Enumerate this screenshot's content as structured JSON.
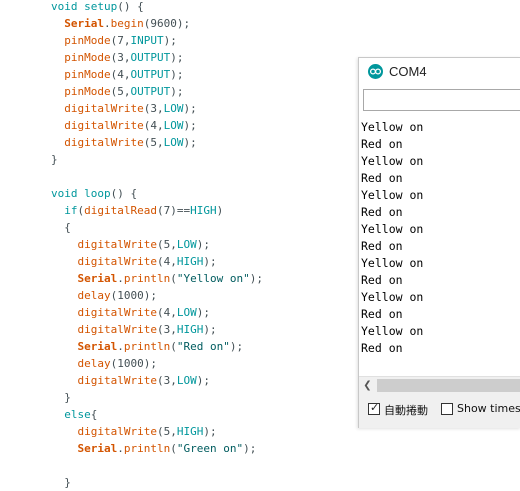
{
  "editor": {
    "lines": [
      [
        {
          "t": "void",
          "c": "kw"
        },
        {
          "t": " ",
          "c": "plain"
        },
        {
          "t": "setup",
          "c": "kw"
        },
        {
          "t": "() {",
          "c": "plain"
        }
      ],
      [
        {
          "t": "  ",
          "c": "plain"
        },
        {
          "t": "Serial",
          "c": "obj"
        },
        {
          "t": ".",
          "c": "plain"
        },
        {
          "t": "begin",
          "c": "builtin"
        },
        {
          "t": "(9600);",
          "c": "plain"
        }
      ],
      [
        {
          "t": "  ",
          "c": "plain"
        },
        {
          "t": "pinMode",
          "c": "builtin"
        },
        {
          "t": "(7,",
          "c": "plain"
        },
        {
          "t": "INPUT",
          "c": "kw"
        },
        {
          "t": ");",
          "c": "plain"
        }
      ],
      [
        {
          "t": "  ",
          "c": "plain"
        },
        {
          "t": "pinMode",
          "c": "builtin"
        },
        {
          "t": "(3,",
          "c": "plain"
        },
        {
          "t": "OUTPUT",
          "c": "kw"
        },
        {
          "t": ");",
          "c": "plain"
        }
      ],
      [
        {
          "t": "  ",
          "c": "plain"
        },
        {
          "t": "pinMode",
          "c": "builtin"
        },
        {
          "t": "(4,",
          "c": "plain"
        },
        {
          "t": "OUTPUT",
          "c": "kw"
        },
        {
          "t": ");",
          "c": "plain"
        }
      ],
      [
        {
          "t": "  ",
          "c": "plain"
        },
        {
          "t": "pinMode",
          "c": "builtin"
        },
        {
          "t": "(5,",
          "c": "plain"
        },
        {
          "t": "OUTPUT",
          "c": "kw"
        },
        {
          "t": ");",
          "c": "plain"
        }
      ],
      [
        {
          "t": "  ",
          "c": "plain"
        },
        {
          "t": "digitalWrite",
          "c": "builtin"
        },
        {
          "t": "(3,",
          "c": "plain"
        },
        {
          "t": "LOW",
          "c": "kw"
        },
        {
          "t": ");",
          "c": "plain"
        }
      ],
      [
        {
          "t": "  ",
          "c": "plain"
        },
        {
          "t": "digitalWrite",
          "c": "builtin"
        },
        {
          "t": "(4,",
          "c": "plain"
        },
        {
          "t": "LOW",
          "c": "kw"
        },
        {
          "t": ");",
          "c": "plain"
        }
      ],
      [
        {
          "t": "  ",
          "c": "plain"
        },
        {
          "t": "digitalWrite",
          "c": "builtin"
        },
        {
          "t": "(5,",
          "c": "plain"
        },
        {
          "t": "LOW",
          "c": "kw"
        },
        {
          "t": ");",
          "c": "plain"
        }
      ],
      [
        {
          "t": "}",
          "c": "plain"
        }
      ],
      [],
      [
        {
          "t": "void",
          "c": "kw"
        },
        {
          "t": " ",
          "c": "plain"
        },
        {
          "t": "loop",
          "c": "kw"
        },
        {
          "t": "() {",
          "c": "plain"
        }
      ],
      [
        {
          "t": "  ",
          "c": "plain"
        },
        {
          "t": "if",
          "c": "kw"
        },
        {
          "t": "(",
          "c": "plain"
        },
        {
          "t": "digitalRead",
          "c": "builtin"
        },
        {
          "t": "(7)==",
          "c": "plain"
        },
        {
          "t": "HIGH",
          "c": "kw"
        },
        {
          "t": ")",
          "c": "plain"
        }
      ],
      [
        {
          "t": "  {",
          "c": "plain"
        }
      ],
      [
        {
          "t": "    ",
          "c": "plain"
        },
        {
          "t": "digitalWrite",
          "c": "builtin"
        },
        {
          "t": "(5,",
          "c": "plain"
        },
        {
          "t": "LOW",
          "c": "kw"
        },
        {
          "t": ");",
          "c": "plain"
        }
      ],
      [
        {
          "t": "    ",
          "c": "plain"
        },
        {
          "t": "digitalWrite",
          "c": "builtin"
        },
        {
          "t": "(4,",
          "c": "plain"
        },
        {
          "t": "HIGH",
          "c": "kw"
        },
        {
          "t": ");",
          "c": "plain"
        }
      ],
      [
        {
          "t": "    ",
          "c": "plain"
        },
        {
          "t": "Serial",
          "c": "obj"
        },
        {
          "t": ".",
          "c": "plain"
        },
        {
          "t": "println",
          "c": "builtin"
        },
        {
          "t": "(",
          "c": "plain"
        },
        {
          "t": "\"Yellow on\"",
          "c": "str"
        },
        {
          "t": ");",
          "c": "plain"
        }
      ],
      [
        {
          "t": "    ",
          "c": "plain"
        },
        {
          "t": "delay",
          "c": "builtin"
        },
        {
          "t": "(1000);",
          "c": "plain"
        }
      ],
      [
        {
          "t": "    ",
          "c": "plain"
        },
        {
          "t": "digitalWrite",
          "c": "builtin"
        },
        {
          "t": "(4,",
          "c": "plain"
        },
        {
          "t": "LOW",
          "c": "kw"
        },
        {
          "t": ");",
          "c": "plain"
        }
      ],
      [
        {
          "t": "    ",
          "c": "plain"
        },
        {
          "t": "digitalWrite",
          "c": "builtin"
        },
        {
          "t": "(3,",
          "c": "plain"
        },
        {
          "t": "HIGH",
          "c": "kw"
        },
        {
          "t": ");",
          "c": "plain"
        }
      ],
      [
        {
          "t": "    ",
          "c": "plain"
        },
        {
          "t": "Serial",
          "c": "obj"
        },
        {
          "t": ".",
          "c": "plain"
        },
        {
          "t": "println",
          "c": "builtin"
        },
        {
          "t": "(",
          "c": "plain"
        },
        {
          "t": "\"Red on\"",
          "c": "str"
        },
        {
          "t": ");",
          "c": "plain"
        }
      ],
      [
        {
          "t": "    ",
          "c": "plain"
        },
        {
          "t": "delay",
          "c": "builtin"
        },
        {
          "t": "(1000);",
          "c": "plain"
        }
      ],
      [
        {
          "t": "    ",
          "c": "plain"
        },
        {
          "t": "digitalWrite",
          "c": "builtin"
        },
        {
          "t": "(3,",
          "c": "plain"
        },
        {
          "t": "LOW",
          "c": "kw"
        },
        {
          "t": ");",
          "c": "plain"
        }
      ],
      [
        {
          "t": "  }",
          "c": "plain"
        }
      ],
      [
        {
          "t": "  ",
          "c": "plain"
        },
        {
          "t": "else",
          "c": "kw"
        },
        {
          "t": "{",
          "c": "plain"
        }
      ],
      [
        {
          "t": "    ",
          "c": "plain"
        },
        {
          "t": "digitalWrite",
          "c": "builtin"
        },
        {
          "t": "(5,",
          "c": "plain"
        },
        {
          "t": "HIGH",
          "c": "kw"
        },
        {
          "t": ");",
          "c": "plain"
        }
      ],
      [
        {
          "t": "    ",
          "c": "plain"
        },
        {
          "t": "Serial",
          "c": "obj"
        },
        {
          "t": ".",
          "c": "plain"
        },
        {
          "t": "println",
          "c": "builtin"
        },
        {
          "t": "(",
          "c": "plain"
        },
        {
          "t": "\"Green on\"",
          "c": "str"
        },
        {
          "t": ");",
          "c": "plain"
        }
      ],
      [],
      [
        {
          "t": "  }",
          "c": "plain"
        }
      ]
    ]
  },
  "serial_monitor": {
    "title": "COM4",
    "send_input_value": "",
    "output_lines": [
      "Yellow on",
      "Red on",
      "Yellow on",
      "Red on",
      "Yellow on",
      "Red on",
      "Yellow on",
      "Red on",
      "Yellow on",
      "Red on",
      "Yellow on",
      "Red on",
      "Yellow on",
      "Red on"
    ],
    "autoscroll_label": "自動捲動",
    "autoscroll_checked": true,
    "timestamp_label": "Show timestamp",
    "timestamp_checked": false,
    "scroll_left_icon": "chevron-left-icon"
  },
  "colors": {
    "keyword": "#00979c",
    "builtin": "#d35400",
    "string": "#005c5f",
    "plain": "#434f54",
    "arduino_brand": "#00979c"
  }
}
